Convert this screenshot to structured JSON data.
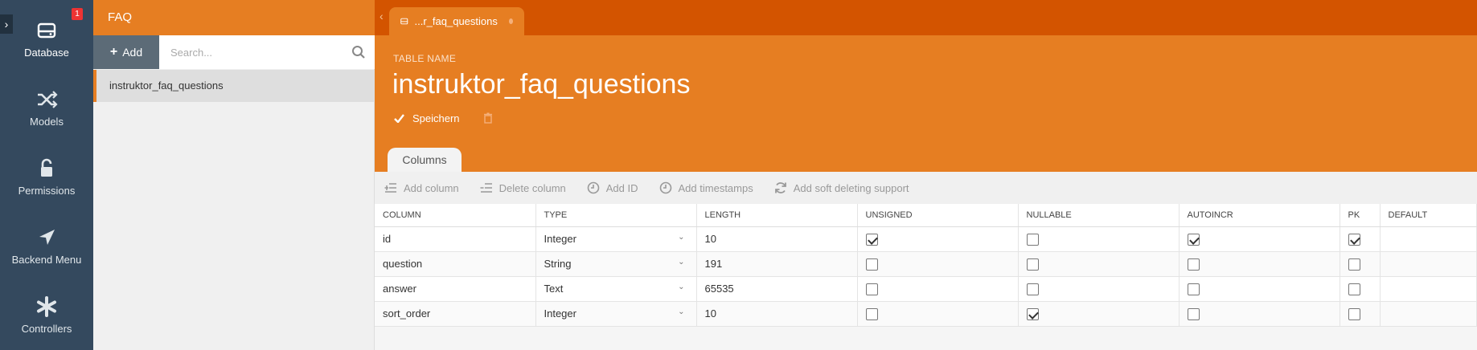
{
  "nav": {
    "badge": "1",
    "items": [
      {
        "label": "Database",
        "icon": "database-icon"
      },
      {
        "label": "Models",
        "icon": "shuffle-icon"
      },
      {
        "label": "Permissions",
        "icon": "unlock-icon"
      },
      {
        "label": "Backend Menu",
        "icon": "location-arrow-icon"
      },
      {
        "label": "Controllers",
        "icon": "asterisk-icon"
      }
    ]
  },
  "sidebar": {
    "title": "FAQ",
    "add_label": "Add",
    "search_placeholder": "Search...",
    "items": [
      "instruktor_faq_questions"
    ]
  },
  "tab": {
    "label": "...r_faq_questions"
  },
  "table_header": {
    "label": "TABLE NAME",
    "name": "instruktor_faq_questions",
    "save_label": "Speichern"
  },
  "columns_tab": "Columns",
  "toolbar": {
    "add_column": "Add column",
    "delete_column": "Delete column",
    "add_id": "Add ID",
    "add_timestamps": "Add timestamps",
    "add_soft_delete": "Add soft deleting support"
  },
  "grid": {
    "headers": [
      "COLUMN",
      "TYPE",
      "LENGTH",
      "UNSIGNED",
      "NULLABLE",
      "AUTOINCR",
      "PK",
      "DEFAULT"
    ],
    "rows": [
      {
        "column": "id",
        "type": "Integer",
        "length": "10",
        "unsigned": true,
        "nullable": false,
        "autoincr": true,
        "pk": true,
        "default": ""
      },
      {
        "column": "question",
        "type": "String",
        "length": "191",
        "unsigned": false,
        "nullable": false,
        "autoincr": false,
        "pk": false,
        "default": ""
      },
      {
        "column": "answer",
        "type": "Text",
        "length": "65535",
        "unsigned": false,
        "nullable": false,
        "autoincr": false,
        "pk": false,
        "default": ""
      },
      {
        "column": "sort_order",
        "type": "Integer",
        "length": "10",
        "unsigned": false,
        "nullable": true,
        "autoincr": false,
        "pk": false,
        "default": ""
      }
    ]
  },
  "colors": {
    "sidebar": "#34495e",
    "accent": "#e67e22",
    "topbar": "#d35400"
  }
}
